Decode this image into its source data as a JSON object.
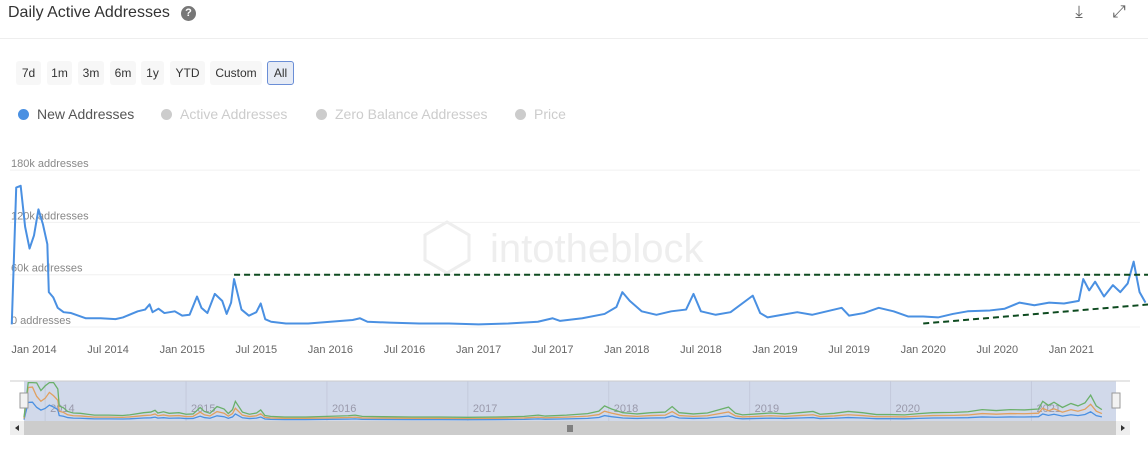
{
  "header": {
    "title": "Daily Active Addresses",
    "help_icon": "question-icon",
    "download_icon": "download-icon",
    "fullscreen_icon": "expand-icon"
  },
  "ranges": [
    "7d",
    "1m",
    "3m",
    "6m",
    "1y",
    "YTD",
    "Custom",
    "All"
  ],
  "active_range": "All",
  "legend": [
    {
      "label": "New Addresses",
      "color": "#4a90e2",
      "active": true
    },
    {
      "label": "Active Addresses",
      "color": "#cccccc",
      "active": false
    },
    {
      "label": "Zero Balance Addresses",
      "color": "#cccccc",
      "active": false
    },
    {
      "label": "Price",
      "color": "#cccccc",
      "active": false
    }
  ],
  "watermark": "intotheblock",
  "chart_data": {
    "type": "line",
    "title": "Daily Active Addresses",
    "ylabel": "addresses",
    "ylim": [
      0,
      180000
    ],
    "y_ticks": [
      "0 addresses",
      "60k addresses",
      "120k addresses",
      "180k addresses"
    ],
    "x_ticks": [
      "Jan 2014",
      "Jul 2014",
      "Jan 2015",
      "Jul 2015",
      "Jan 2016",
      "Jul 2016",
      "Jan 2017",
      "Jul 2017",
      "Jan 2018",
      "Jul 2018",
      "Jan 2019",
      "Jul 2019",
      "Jan 2020",
      "Jul 2020",
      "Jan 2021"
    ],
    "xlim": [
      2013.85,
      2021.6
    ],
    "series": [
      {
        "name": "New Addresses",
        "color": "#4a90e2",
        "points": [
          [
            2013.85,
            3
          ],
          [
            2013.88,
            160
          ],
          [
            2013.91,
            162
          ],
          [
            2013.94,
            115
          ],
          [
            2013.97,
            90
          ],
          [
            2014.0,
            105
          ],
          [
            2014.03,
            135
          ],
          [
            2014.06,
            118
          ],
          [
            2014.09,
            95
          ],
          [
            2014.1,
            40
          ],
          [
            2014.13,
            34
          ],
          [
            2014.16,
            22
          ],
          [
            2014.2,
            17
          ],
          [
            2014.25,
            16
          ],
          [
            2014.3,
            13
          ],
          [
            2014.35,
            10
          ],
          [
            2014.45,
            10
          ],
          [
            2014.55,
            9
          ],
          [
            2014.6,
            11
          ],
          [
            2014.7,
            18
          ],
          [
            2014.75,
            20
          ],
          [
            2014.78,
            26
          ],
          [
            2014.8,
            17
          ],
          [
            2014.84,
            21
          ],
          [
            2014.88,
            16
          ],
          [
            2014.95,
            18
          ],
          [
            2015.0,
            13
          ],
          [
            2015.05,
            14
          ],
          [
            2015.1,
            35
          ],
          [
            2015.13,
            22
          ],
          [
            2015.17,
            16
          ],
          [
            2015.22,
            38
          ],
          [
            2015.27,
            30
          ],
          [
            2015.3,
            15
          ],
          [
            2015.33,
            28
          ],
          [
            2015.35,
            55
          ],
          [
            2015.4,
            20
          ],
          [
            2015.45,
            13
          ],
          [
            2015.5,
            17
          ],
          [
            2015.53,
            27
          ],
          [
            2015.56,
            9
          ],
          [
            2015.6,
            6
          ],
          [
            2015.7,
            4
          ],
          [
            2015.85,
            4
          ],
          [
            2016.0,
            6
          ],
          [
            2016.15,
            8
          ],
          [
            2016.2,
            10
          ],
          [
            2016.25,
            6
          ],
          [
            2016.4,
            5
          ],
          [
            2016.6,
            4
          ],
          [
            2016.8,
            4
          ],
          [
            2017.0,
            3
          ],
          [
            2017.2,
            4
          ],
          [
            2017.4,
            6
          ],
          [
            2017.5,
            10
          ],
          [
            2017.55,
            7
          ],
          [
            2017.7,
            10
          ],
          [
            2017.85,
            15
          ],
          [
            2017.93,
            23
          ],
          [
            2017.97,
            40
          ],
          [
            2018.02,
            30
          ],
          [
            2018.1,
            18
          ],
          [
            2018.2,
            14
          ],
          [
            2018.3,
            18
          ],
          [
            2018.4,
            20
          ],
          [
            2018.45,
            38
          ],
          [
            2018.5,
            18
          ],
          [
            2018.6,
            14
          ],
          [
            2018.7,
            17
          ],
          [
            2018.85,
            36
          ],
          [
            2018.9,
            16
          ],
          [
            2018.95,
            11
          ],
          [
            2019.05,
            14
          ],
          [
            2019.15,
            17
          ],
          [
            2019.25,
            14
          ],
          [
            2019.35,
            18
          ],
          [
            2019.45,
            22
          ],
          [
            2019.5,
            13
          ],
          [
            2019.6,
            16
          ],
          [
            2019.7,
            22
          ],
          [
            2019.8,
            18
          ],
          [
            2019.9,
            12
          ],
          [
            2020.0,
            12
          ],
          [
            2020.1,
            11
          ],
          [
            2020.2,
            15
          ],
          [
            2020.3,
            18
          ],
          [
            2020.45,
            19
          ],
          [
            2020.55,
            21
          ],
          [
            2020.65,
            28
          ],
          [
            2020.75,
            25
          ],
          [
            2020.85,
            28
          ],
          [
            2020.95,
            27
          ],
          [
            2021.05,
            30
          ],
          [
            2021.08,
            55
          ],
          [
            2021.12,
            42
          ],
          [
            2021.16,
            52
          ],
          [
            2021.22,
            35
          ],
          [
            2021.28,
            48
          ],
          [
            2021.33,
            40
          ],
          [
            2021.38,
            50
          ],
          [
            2021.42,
            75
          ],
          [
            2021.46,
            40
          ],
          [
            2021.5,
            28
          ]
        ]
      }
    ],
    "annotations": [
      {
        "type": "dashed-line",
        "color": "#0d4a1f",
        "from": [
          2015.35,
          60
        ],
        "to": [
          2021.6,
          60
        ]
      },
      {
        "type": "dashed-line",
        "color": "#0d4a1f",
        "from": [
          2020.0,
          4
        ],
        "to": [
          2021.6,
          27
        ]
      }
    ],
    "navigator": {
      "labels": [
        "2014",
        "2015",
        "2016",
        "2017",
        "2018",
        "2019",
        "2020",
        "2021"
      ],
      "series_colors": [
        "#4a90e2",
        "#e0a060",
        "#6ab06a"
      ]
    }
  }
}
